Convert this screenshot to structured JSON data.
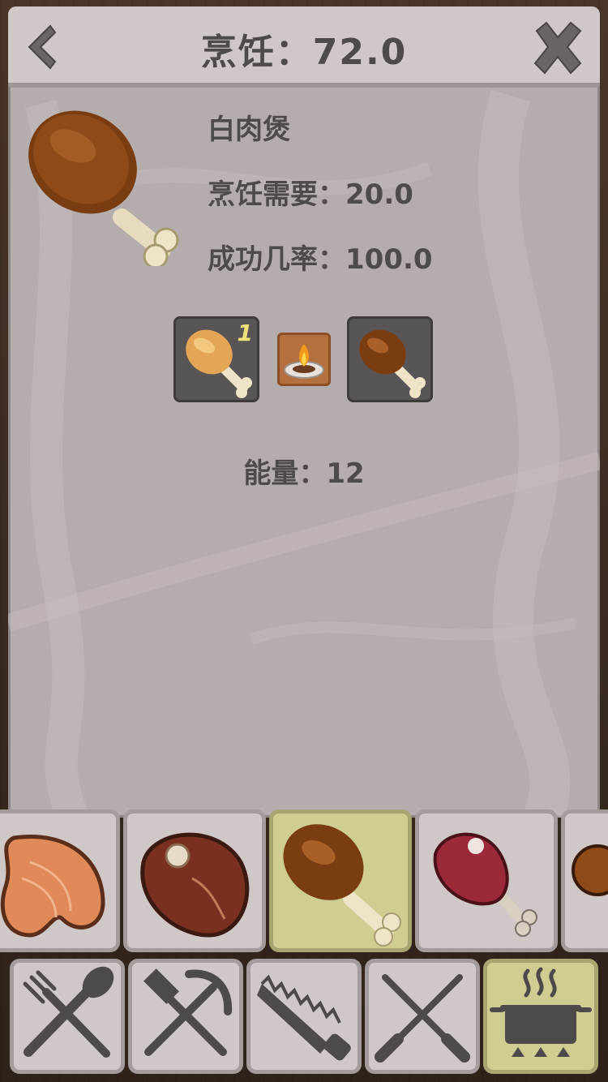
{
  "header": {
    "title": "烹饪：72.0",
    "back_icon": "chevron-left-icon",
    "close_icon": "close-x-icon"
  },
  "item": {
    "name": "白肉煲",
    "cook_requirement": "烹饪需要：20.0",
    "success_rate": "成功几率：100.0",
    "icon": "roasted-drumstick-icon"
  },
  "recipe": {
    "input": {
      "icon": "raw-drumstick-icon",
      "count": "1"
    },
    "tool_icon": "campfire-icon",
    "output": {
      "icon": "roasted-drumstick-icon"
    }
  },
  "energy": "能量：12",
  "recipes": [
    {
      "icon": "salmon-steak-icon",
      "selected": false
    },
    {
      "icon": "beef-steak-icon",
      "selected": false
    },
    {
      "icon": "roasted-drumstick-icon",
      "selected": true
    },
    {
      "icon": "ham-leg-icon",
      "selected": false
    },
    {
      "icon": "partial-food-icon",
      "selected": false
    }
  ],
  "categories": [
    {
      "icon": "fork-spoon-icon",
      "active": false
    },
    {
      "icon": "pickaxe-hammer-icon",
      "active": false
    },
    {
      "icon": "saw-icon",
      "active": false
    },
    {
      "icon": "crossed-knives-icon",
      "active": false
    },
    {
      "icon": "cooking-pot-icon",
      "active": true
    }
  ],
  "colors": {
    "panel": "#b5acac",
    "text": "#4f4a4a",
    "selected": "#cfcd92"
  }
}
